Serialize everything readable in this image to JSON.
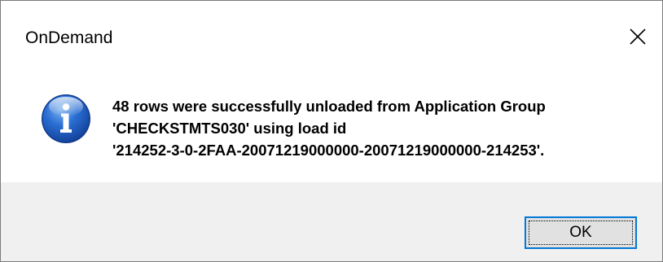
{
  "window": {
    "title": "OnDemand",
    "close_icon": "close-icon"
  },
  "message": {
    "icon": "info-icon",
    "text": "48 rows were successfully unloaded from Application Group\n'CHECKSTMTS030' using load id\n'214252-3-0-2FAA-20071219000000-20071219000000-214253'."
  },
  "buttons": {
    "ok_label": "OK"
  },
  "colors": {
    "footer_bg": "#f0f0f0",
    "button_bg": "#e1e1e1",
    "button_focus_border": "#0078d7",
    "icon_blue": "#1e5bbf"
  }
}
